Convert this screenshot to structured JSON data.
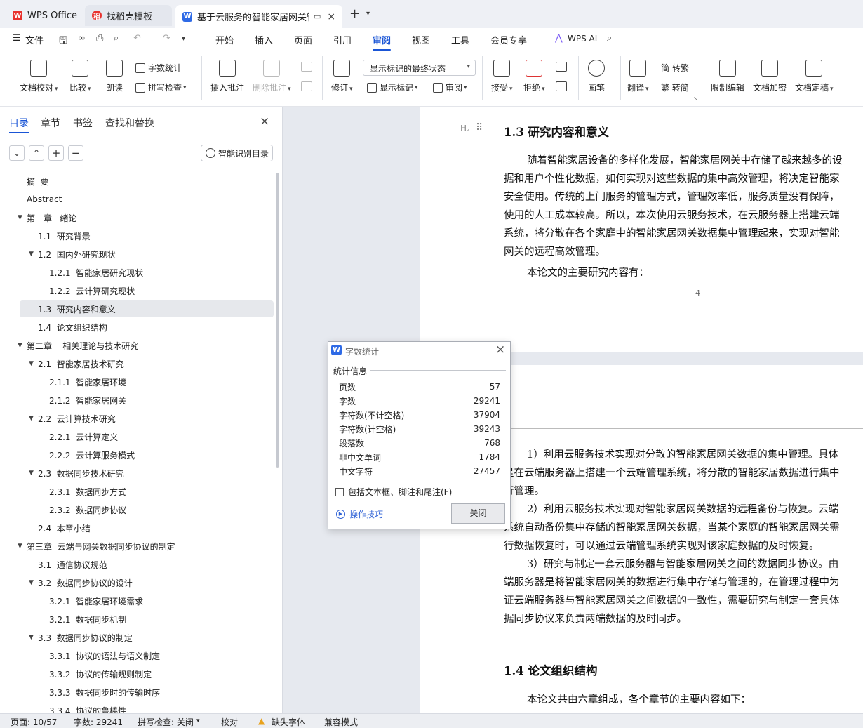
{
  "tabs": [
    {
      "label": "WPS Office",
      "icon": "wps-logo-icon"
    },
    {
      "label": "找稻壳模板",
      "icon": "docer-icon"
    },
    {
      "label": "基于云服务的智能家居网关管",
      "icon": "writer-doc-icon"
    }
  ],
  "menu": {
    "file_label": "文件",
    "tabs": [
      "开始",
      "插入",
      "页面",
      "引用",
      "审阅",
      "视图",
      "工具",
      "会员专享"
    ],
    "active": "审阅",
    "wps_ai": "WPS AI"
  },
  "ribbon": {
    "proofread": "文档校对",
    "compare": "比较",
    "read_aloud": "朗读",
    "word_count": "字数统计",
    "spell_check": "拼写检查",
    "insert_comment": "插入批注",
    "delete_comment": "删除批注",
    "revise": "修订",
    "markup_state": "显示标记的最终状态",
    "show_markup": "显示标记",
    "review": "审阅",
    "accept": "接受",
    "reject": "拒绝",
    "pen": "画笔",
    "translate": "翻译",
    "to_traditional": "简 转繁",
    "to_simplified": "繁 转简",
    "restrict_edit": "限制编辑",
    "encrypt": "文档加密",
    "finalize": "文档定稿"
  },
  "nav": {
    "tabs": [
      "目录",
      "章节",
      "书签",
      "查找和替换"
    ],
    "smart_toc": "智能识别目录",
    "toc": [
      {
        "text": "摘  要",
        "level": 0,
        "arrow": false
      },
      {
        "text": "Abstract",
        "level": 0,
        "arrow": false
      },
      {
        "text": "第一章   绪论",
        "level": 0,
        "arrow": true
      },
      {
        "text": "1.1  研究背景",
        "level": 1,
        "arrow": false
      },
      {
        "text": "1.2  国内外研究现状",
        "level": 1,
        "arrow": true
      },
      {
        "text": "1.2.1  智能家居研究现状",
        "level": 2,
        "arrow": false
      },
      {
        "text": "1.2.2  云计算研究现状",
        "level": 2,
        "arrow": false
      },
      {
        "text": "1.3  研究内容和意义",
        "level": 1,
        "arrow": false,
        "selected": true
      },
      {
        "text": "1.4  论文组织结构",
        "level": 1,
        "arrow": false
      },
      {
        "text": "第二章    相关理论与技术研究",
        "level": 0,
        "arrow": true
      },
      {
        "text": "2.1  智能家居技术研究",
        "level": 1,
        "arrow": true
      },
      {
        "text": "2.1.1  智能家居环境",
        "level": 2,
        "arrow": false
      },
      {
        "text": "2.1.2  智能家居网关",
        "level": 2,
        "arrow": false
      },
      {
        "text": "2.2  云计算技术研究",
        "level": 1,
        "arrow": true
      },
      {
        "text": "2.2.1  云计算定义",
        "level": 2,
        "arrow": false
      },
      {
        "text": "2.2.2  云计算服务模式",
        "level": 2,
        "arrow": false
      },
      {
        "text": "2.3  数据同步技术研究",
        "level": 1,
        "arrow": true
      },
      {
        "text": "2.3.1  数据同步方式",
        "level": 2,
        "arrow": false
      },
      {
        "text": "2.3.2  数据同步协议",
        "level": 2,
        "arrow": false
      },
      {
        "text": "2.4  本章小结",
        "level": 1,
        "arrow": false
      },
      {
        "text": "第三章  云端与网关数据同步协议的制定",
        "level": 0,
        "arrow": true
      },
      {
        "text": "3.1  通信协议规范",
        "level": 1,
        "arrow": false
      },
      {
        "text": "3.2  数据同步协议的设计",
        "level": 1,
        "arrow": true
      },
      {
        "text": "3.2.1  智能家居环境需求",
        "level": 2,
        "arrow": false
      },
      {
        "text": "3.2.1  数据同步机制",
        "level": 2,
        "arrow": false
      },
      {
        "text": "3.3  数据同步协议的制定",
        "level": 1,
        "arrow": true
      },
      {
        "text": "3.3.1  协议的语法与语义制定",
        "level": 2,
        "arrow": false
      },
      {
        "text": "3.3.2  协议的传输规则制定",
        "level": 2,
        "arrow": false
      },
      {
        "text": "3.3.3  数据同步时的传输时序",
        "level": 2,
        "arrow": false
      },
      {
        "text": "3.3.4  协议的鲁棒性",
        "level": 2,
        "arrow": false
      }
    ]
  },
  "doc": {
    "heading_marker": "H₂",
    "h13": "1.3  研究内容和意义",
    "p1": [
      "随着智能家居设备的多样化发展，智能家居网关中存储了越来越多的设",
      "据和用户个性化数据，如何实现对这些数据的集中高效管理，将决定智能家",
      "安全使用。传统的上门服务的管理方式，管理效率低，服务质量没有保障，",
      "使用的人工成本较高。所以，本次使用云服务技术，在云服务器上搭建云端",
      "系统，将分散在各个家庭中的智能家居网关数据集中管理起来，实现对智能",
      "网关的远程高效管理。"
    ],
    "p2": "本论文的主要研究内容有：",
    "page_number": "4",
    "items": [
      "1）利用云服务技术实现对分散的智能家居网关数据的集中管理。具体",
      "是在云端服务器上搭建一个云端管理系统，将分散的智能家居数据进行集中",
      "行管理。",
      "2）利用云服务技术实现对智能家居网关数据的远程备份与恢复。云端",
      "系统自动备份集中存储的智能家居网关数据，当某个家庭的智能家居网关需",
      "行数据恢复时，可以通过云端管理系统实现对该家庭数据的及时恢复。",
      "3）研究与制定一套云服务器与智能家居网关之间的数据同步协议。由",
      "端服务器是将智能家居网关的数据进行集中存储与管理的，在管理过程中为",
      "证云端服务器与智能家居网关之间数据的一致性，需要研究与制定一套具体",
      "据同步协议来负责两端数据的及时同步。"
    ],
    "h14": "1.4  论文组织结构",
    "p3": "本论文共由六章组成，各个章节的主要内容如下："
  },
  "dialog": {
    "title": "字数统计",
    "section": "统计信息",
    "rows": [
      {
        "label": "页数",
        "value": "57"
      },
      {
        "label": "字数",
        "value": "29241"
      },
      {
        "label": "字符数(不计空格)",
        "value": "37904"
      },
      {
        "label": "字符数(计空格)",
        "value": "39243"
      },
      {
        "label": "段落数",
        "value": "768"
      },
      {
        "label": "非中文单词",
        "value": "1784"
      },
      {
        "label": "中文字符",
        "value": "27457"
      }
    ],
    "checkbox": "包括文本框、脚注和尾注(F)",
    "tips": "操作技巧",
    "close": "关闭"
  },
  "status": {
    "page": "页面: 10/57",
    "words": "字数: 29241",
    "spell": "拼写检查: 关闭",
    "proof": "校对",
    "missing_font": "缺失字体",
    "compat": "兼容模式"
  },
  "colors": {
    "accent": "#1a55d6",
    "wps_red": "#e8312d",
    "writer_blue": "#2e6ae6"
  }
}
